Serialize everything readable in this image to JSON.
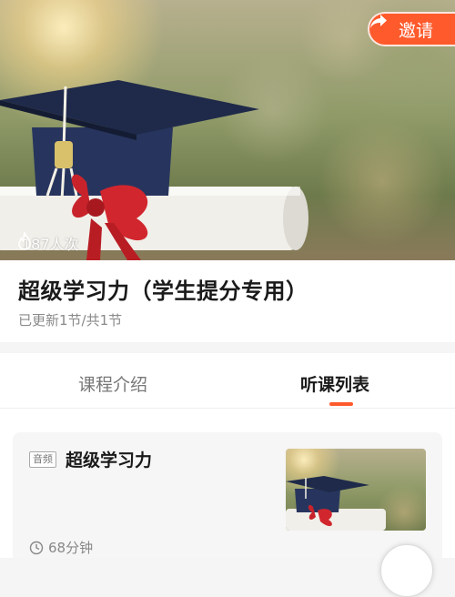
{
  "header": {
    "invite_label": "邀请",
    "views_count": "187人次"
  },
  "course": {
    "title": "超级学习力（学生提分专用）",
    "update_status": "已更新1节/共1节"
  },
  "tabs": [
    {
      "label": "课程介绍",
      "active": false
    },
    {
      "label": "听课列表",
      "active": true
    }
  ],
  "lessons": [
    {
      "tag": "音频",
      "title": "超级学习力",
      "duration": "68分钟"
    }
  ],
  "colors": {
    "accent": "#ff5a2c",
    "muted_text": "#8a8a8a"
  },
  "icons": {
    "invite": "share-arrow-icon",
    "views": "flame-icon",
    "duration": "clock-icon"
  }
}
